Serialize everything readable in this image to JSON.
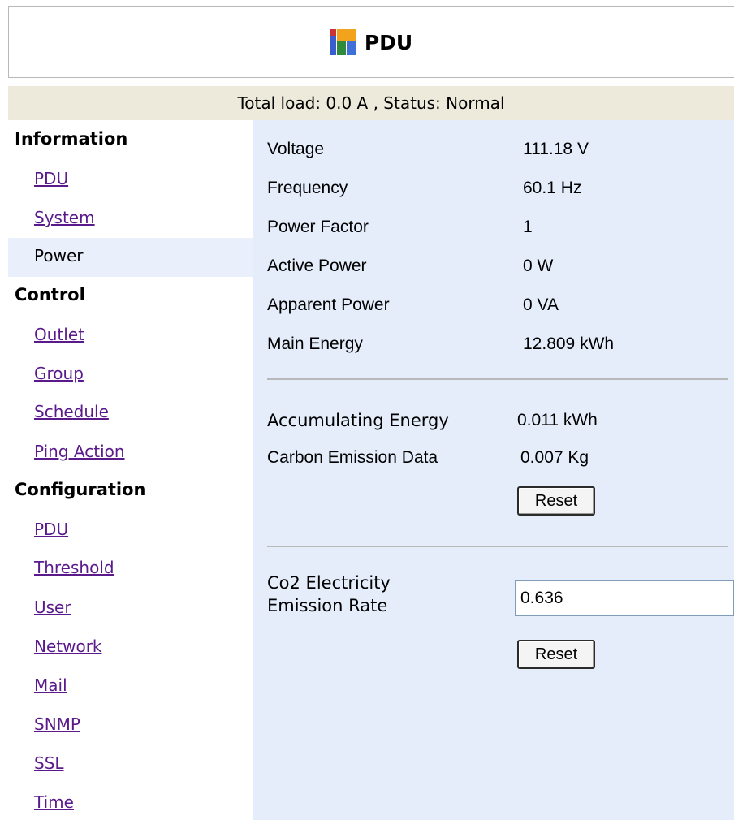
{
  "header": {
    "title": "PDU",
    "logo_icon": "pdu-logo-icon"
  },
  "statusbar": {
    "text": "Total load: 0.0 A , Status: Normal"
  },
  "sidebar": {
    "information": {
      "label": "Information",
      "items": [
        {
          "label": "PDU"
        },
        {
          "label": "System"
        },
        {
          "label": "Power",
          "active": true
        }
      ]
    },
    "control": {
      "label": "Control",
      "items": [
        {
          "label": "Outlet"
        },
        {
          "label": "Group"
        },
        {
          "label": "Schedule"
        },
        {
          "label": "Ping Action"
        }
      ]
    },
    "configuration": {
      "label": "Configuration",
      "items": [
        {
          "label": "PDU"
        },
        {
          "label": "Threshold"
        },
        {
          "label": "User"
        },
        {
          "label": "Network"
        },
        {
          "label": "Mail"
        },
        {
          "label": "SNMP"
        },
        {
          "label": "SSL"
        },
        {
          "label": "Time"
        }
      ]
    }
  },
  "power": {
    "rows": [
      {
        "label": "Voltage",
        "value": "111.18 V"
      },
      {
        "label": "Frequency",
        "value": "60.1 Hz"
      },
      {
        "label": "Power Factor",
        "value": "1"
      },
      {
        "label": "Active Power",
        "value": "0 W"
      },
      {
        "label": "Apparent Power",
        "value": "0 VA"
      },
      {
        "label": "Main Energy",
        "value": "12.809 kWh"
      }
    ],
    "accumulating_label": "Accumulating Energy",
    "accumulating_value": "0.011 kWh",
    "carbon_label": "Carbon Emission Data",
    "carbon_value": "0.007 Kg",
    "reset_label": "Reset",
    "co2_label_line1": "Co2 Electricity",
    "co2_label_line2": "Emission Rate",
    "co2_value": "0.636",
    "reset2_label": "Reset"
  }
}
